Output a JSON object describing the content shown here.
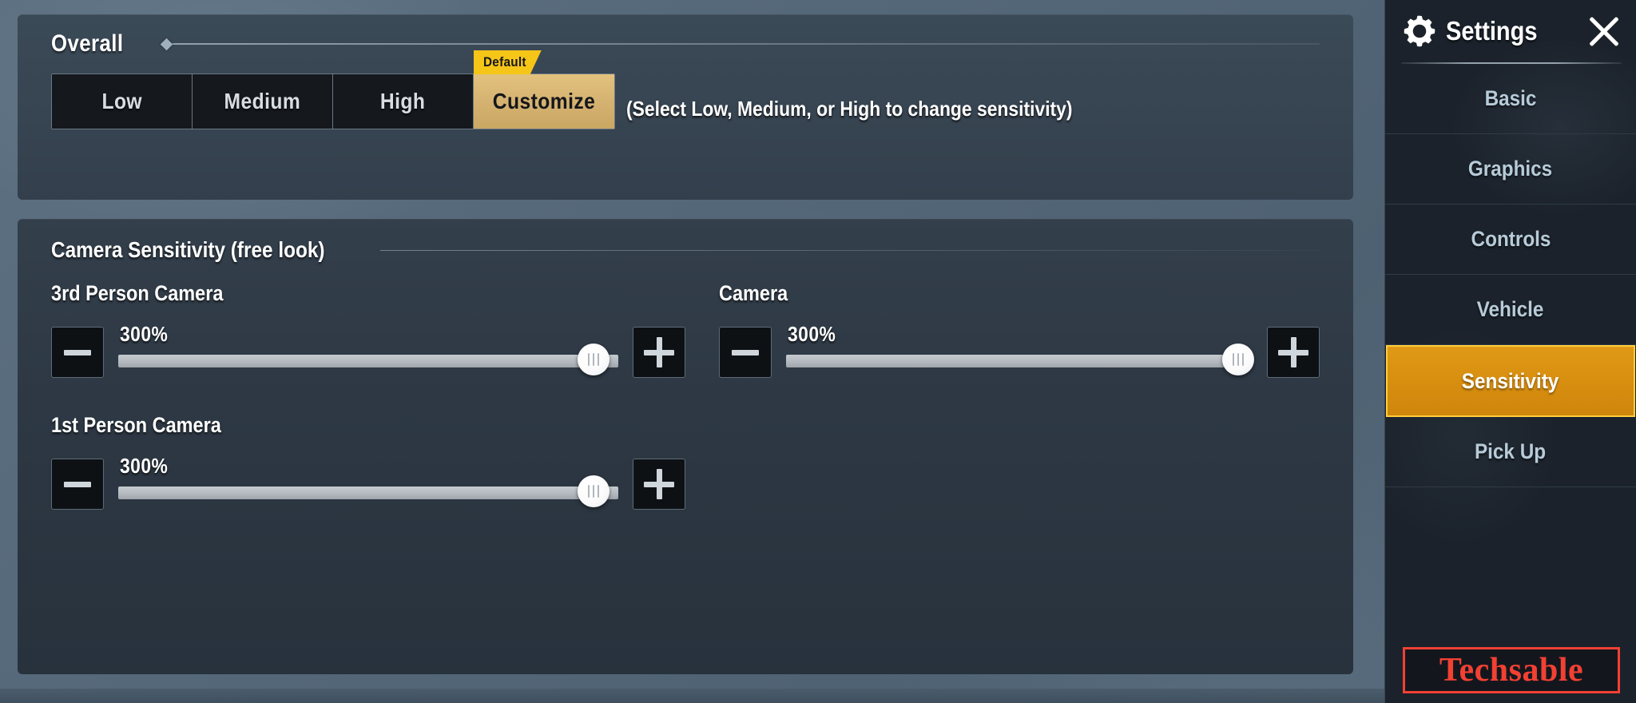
{
  "overall": {
    "title": "Overall",
    "presets": [
      {
        "label": "Low",
        "active": false
      },
      {
        "label": "Medium",
        "active": false
      },
      {
        "label": "High",
        "active": false
      },
      {
        "label": "Customize",
        "active": true,
        "badge": "Default"
      }
    ],
    "hint": "(Select Low, Medium, or High to change sensitivity)"
  },
  "camera_sensitivity": {
    "title": "Camera Sensitivity (free look)",
    "items": [
      {
        "label": "3rd Person Camera",
        "value": "300%",
        "percent": 95,
        "decrease_label": "−",
        "increase_label": "+"
      },
      {
        "label": "Camera",
        "value": "300%",
        "percent": 97,
        "decrease_label": "−",
        "increase_label": "+"
      },
      {
        "label": "1st Person Camera",
        "value": "300%",
        "percent": 95,
        "decrease_label": "−",
        "increase_label": "+"
      }
    ]
  },
  "sidebar": {
    "title": "Settings",
    "gear_icon": "gear-icon",
    "close_icon": "close-icon",
    "items": [
      {
        "label": "Basic",
        "active": false
      },
      {
        "label": "Graphics",
        "active": false
      },
      {
        "label": "Controls",
        "active": false
      },
      {
        "label": "Vehicle",
        "active": false
      },
      {
        "label": "Sensitivity",
        "active": true
      },
      {
        "label": "Pick Up",
        "active": false
      }
    ],
    "watermark": "Techsable"
  },
  "colors": {
    "accent_orange": "#d98f10",
    "accent_border": "#ffcf3e",
    "badge_yellow": "#f5c518",
    "customize_tan": "#d5b271",
    "panel_bg": "#333f4b",
    "sidebar_bg": "#1b222b",
    "watermark_red": "#f24033"
  }
}
